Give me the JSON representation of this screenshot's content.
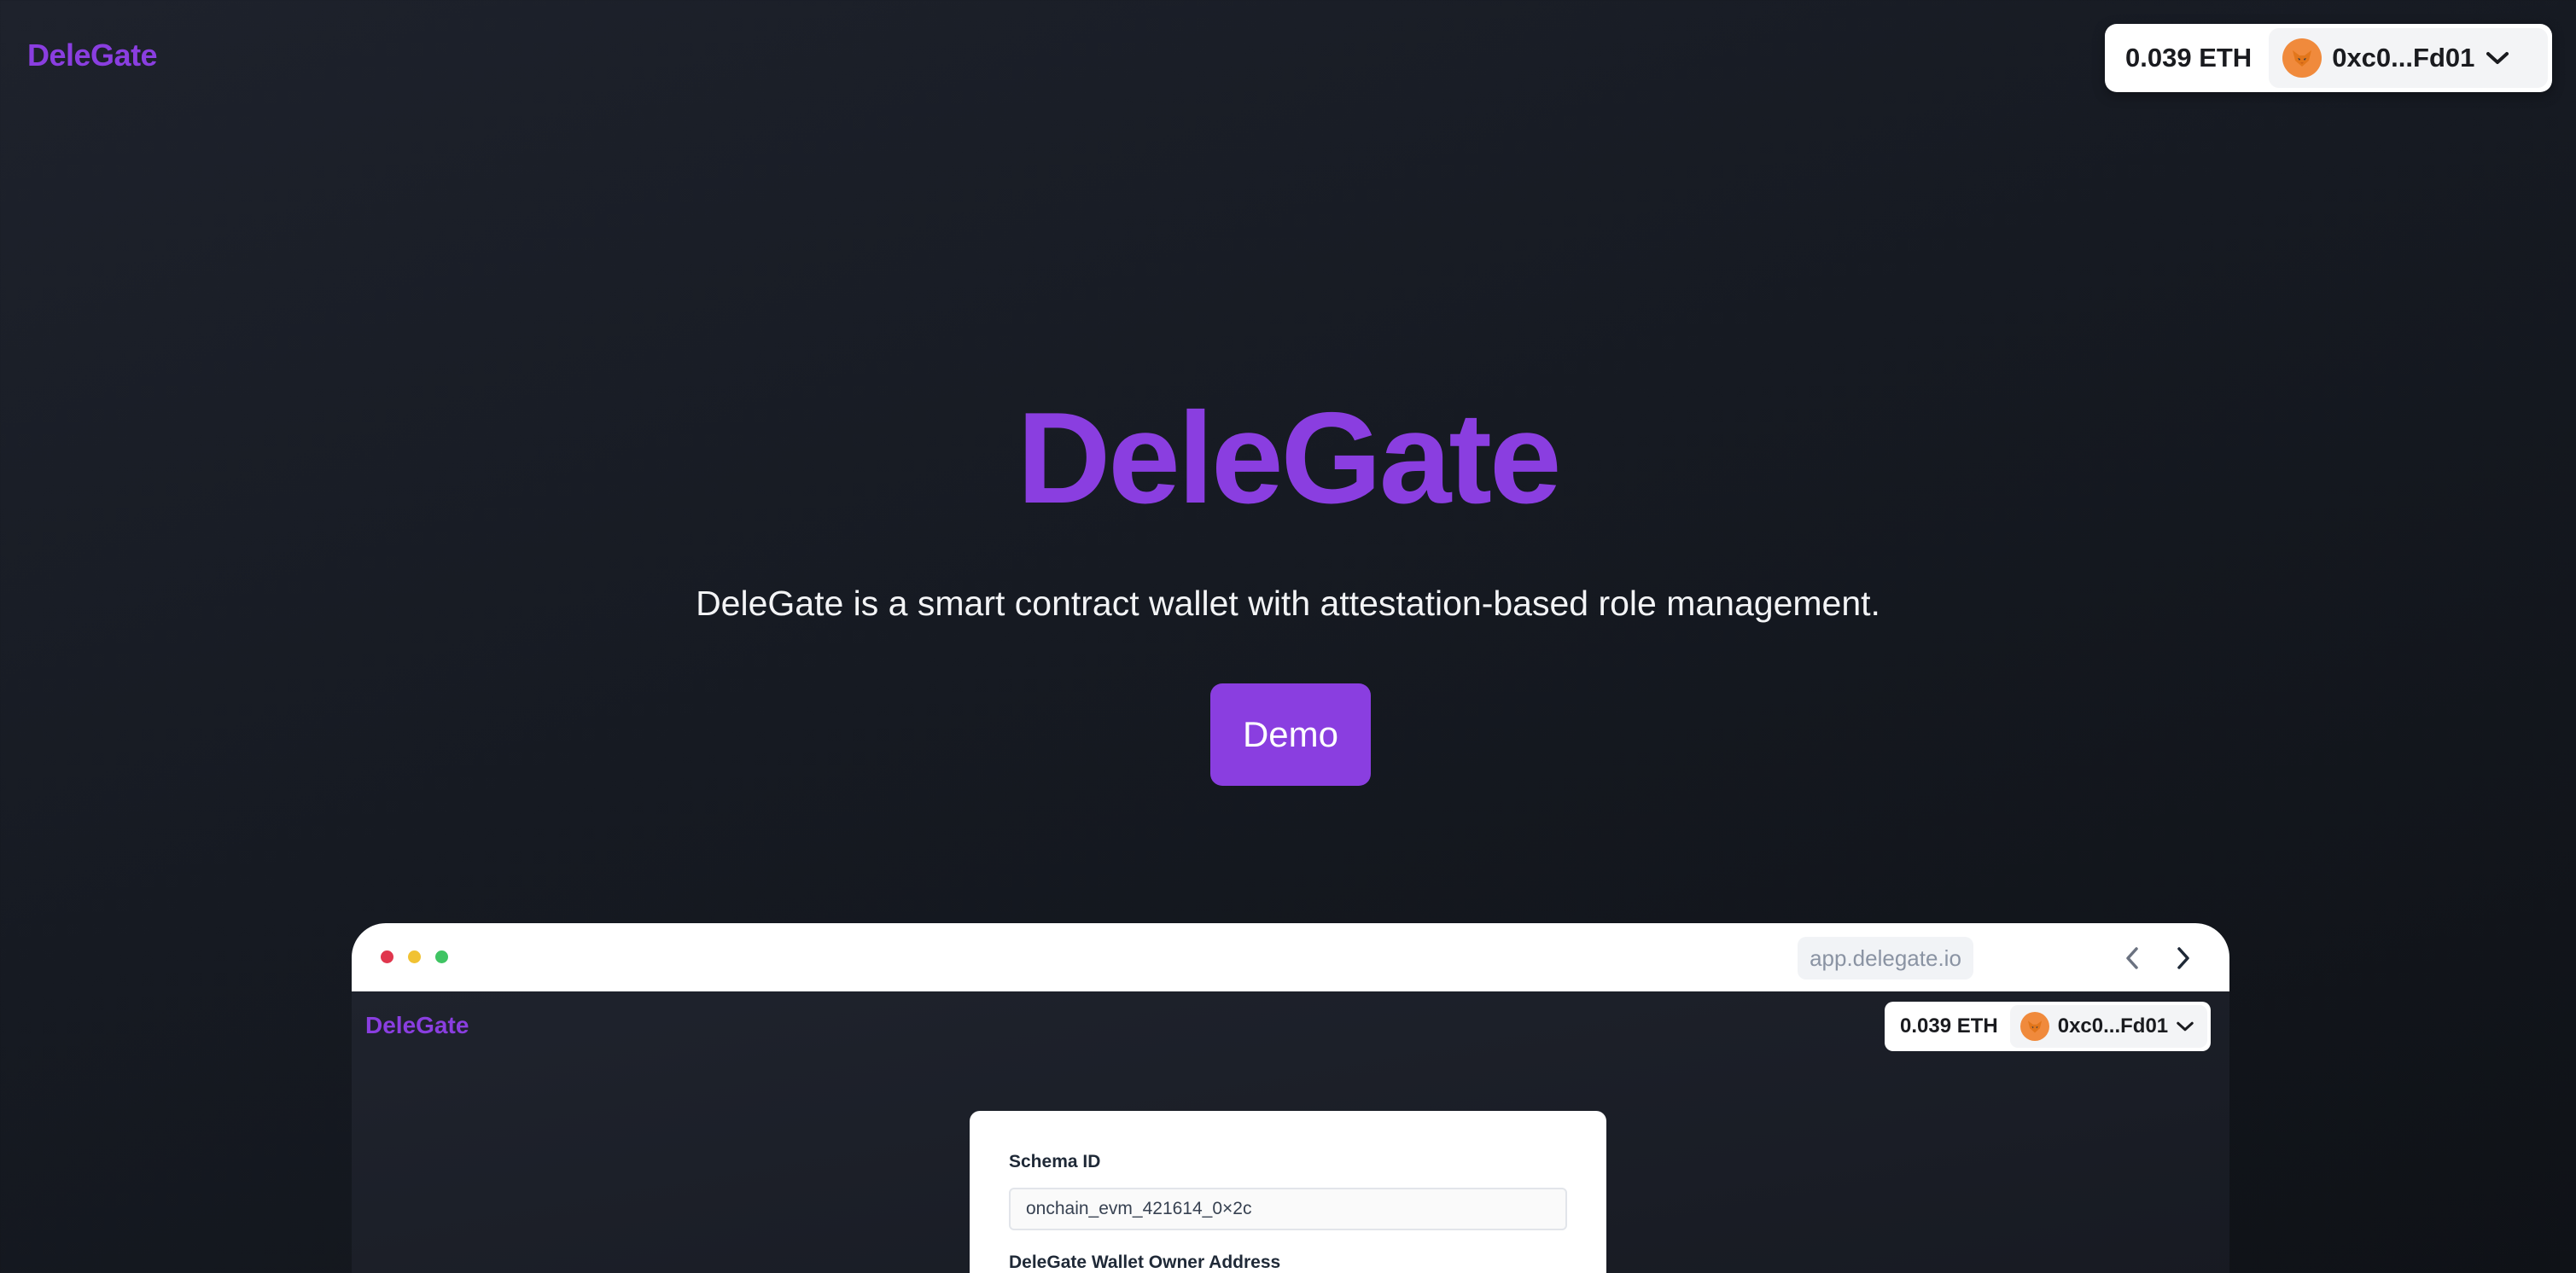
{
  "header": {
    "brand": "DeleGate",
    "wallet": {
      "balance": "0.039 ETH",
      "address": "0xc0...Fd01",
      "avatar_icon": "metamask-fox-icon",
      "dropdown_icon": "chevron-down-icon"
    }
  },
  "hero": {
    "title": "DeleGate",
    "subtitle": "DeleGate is a smart contract wallet with attestation-based role management.",
    "demo_button": "Demo"
  },
  "preview": {
    "url": "app.delegate.io",
    "nav_icons": [
      "chevron-left-icon",
      "chevron-right-icon"
    ],
    "window_dots": [
      "#e0364d",
      "#f1c232",
      "#3fc463"
    ],
    "brand": "DeleGate",
    "wallet": {
      "balance": "0.039 ETH",
      "address": "0xc0...Fd01"
    },
    "form": {
      "schema_label": "Schema ID",
      "schema_value": "onchain_evm_421614_0×2c",
      "owner_label": "DeleGate Wallet Owner Address"
    }
  },
  "colors": {
    "accent": "#8a3ee0",
    "background": "#161a22"
  }
}
